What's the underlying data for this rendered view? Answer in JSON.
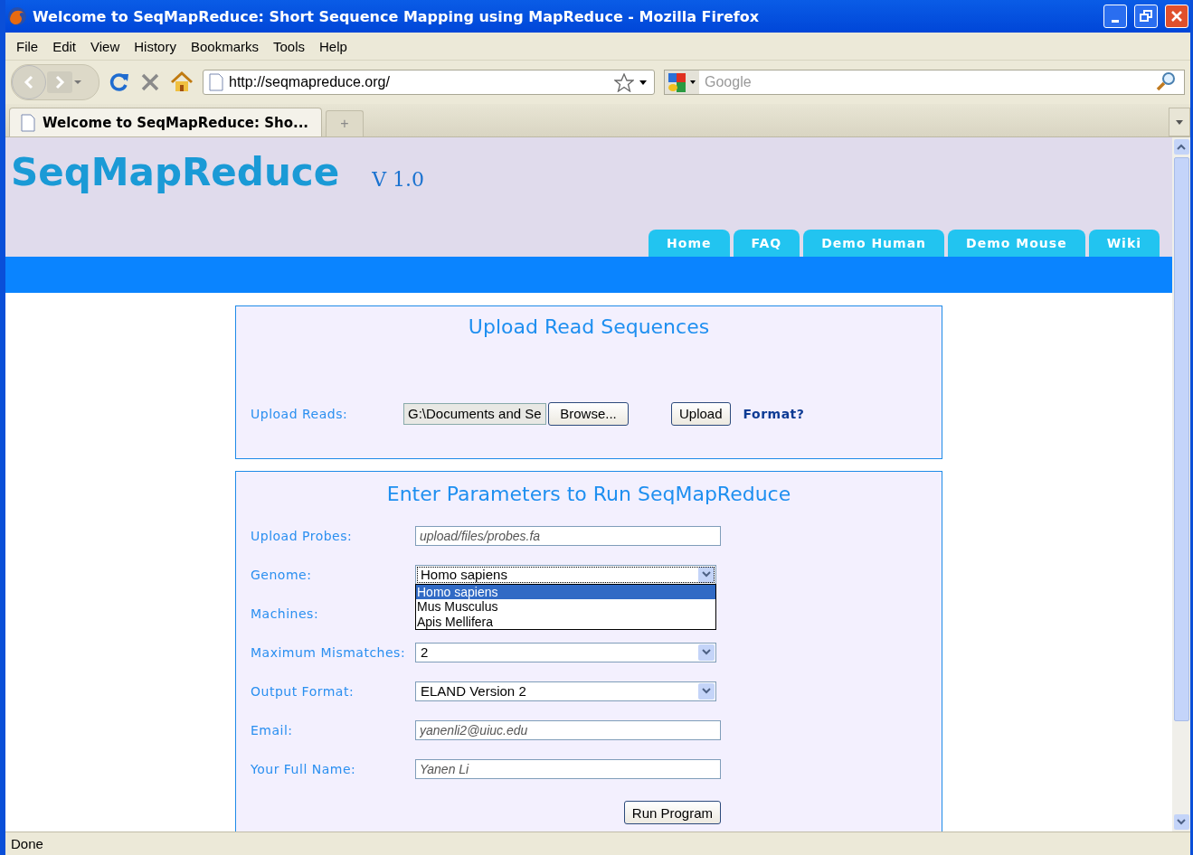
{
  "window": {
    "title": "Welcome to SeqMapReduce: Short Sequence Mapping using MapReduce - Mozilla Firefox"
  },
  "menu": [
    "File",
    "Edit",
    "View",
    "History",
    "Bookmarks",
    "Tools",
    "Help"
  ],
  "address_bar": {
    "value": "http://seqmapreduce.org/"
  },
  "search": {
    "placeholder": "Google"
  },
  "browser_tabs": [
    {
      "label": "Welcome to SeqMapReduce: Sho..."
    }
  ],
  "new_tab": "+",
  "site": {
    "logo": "SeqMapReduce",
    "version": "V 1.0",
    "nav": [
      "Home",
      "FAQ",
      "Demo Human",
      "Demo Mouse",
      "Wiki"
    ]
  },
  "upload_panel": {
    "title": "Upload Read Sequences",
    "label": "Upload Reads:",
    "file_value": "G:\\Documents and Se",
    "browse": "Browse...",
    "upload": "Upload",
    "format_link": "Format?"
  },
  "params_panel": {
    "title": "Enter Parameters to Run SeqMapReduce",
    "rows": [
      {
        "kind": "text",
        "label": "Upload Probes:",
        "placeholder": "upload/files/probes.fa"
      },
      {
        "kind": "select",
        "label": "Genome:",
        "value": "Homo sapiens",
        "expanded": true,
        "options": [
          {
            "label": "Homo sapiens",
            "selected": true
          },
          {
            "label": "Mus Musculus",
            "selected": false
          },
          {
            "label": "Apis Mellifera",
            "selected": false
          }
        ]
      },
      {
        "kind": "hidden",
        "label": "Machines:"
      },
      {
        "kind": "select",
        "label": "Maximum Mismatches:",
        "value": "2",
        "expanded": false
      },
      {
        "kind": "select",
        "label": "Output Format:",
        "value": "ELAND Version 2",
        "expanded": false
      },
      {
        "kind": "text",
        "label": "Email:",
        "placeholder": "yanenli2@uiuc.edu"
      },
      {
        "kind": "text",
        "label": "Your Full Name:",
        "placeholder": "Yanen Li"
      }
    ],
    "run_button": "Run Program"
  },
  "status_bar": "Done"
}
